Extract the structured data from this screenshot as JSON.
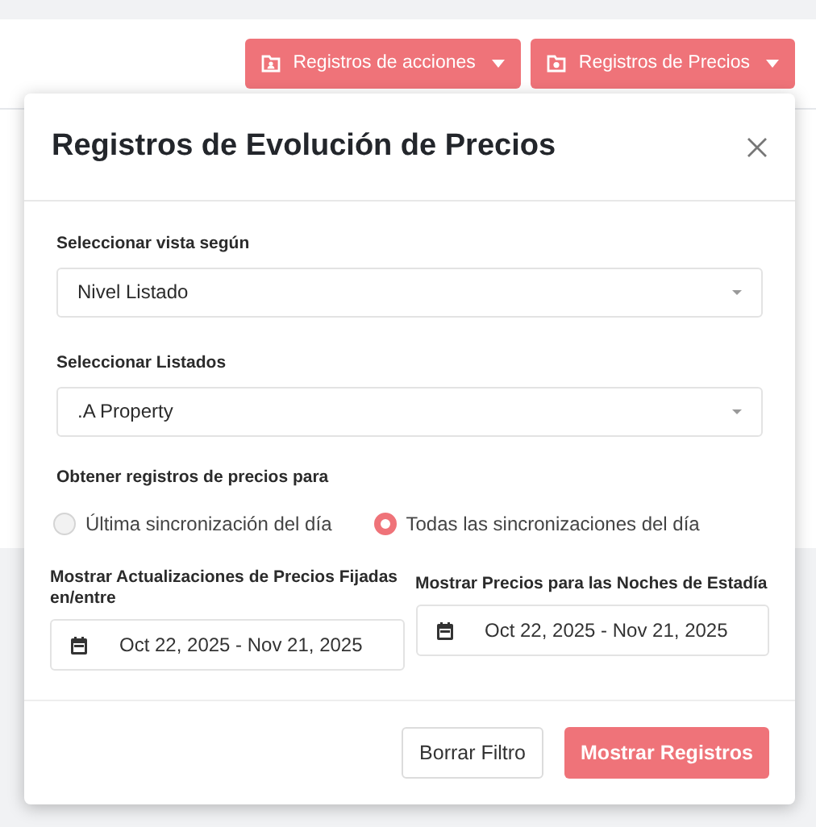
{
  "toolbar": {
    "buttons": [
      {
        "label": "Registros de acciones"
      },
      {
        "label": "Registros de Precios"
      }
    ]
  },
  "dialog": {
    "title": "Registros de Evolución de Precios",
    "view_select": {
      "label": "Seleccionar vista según",
      "value": "Nivel Listado"
    },
    "listing_select": {
      "label": "Seleccionar Listados",
      "value": ".A Property"
    },
    "sync_options": {
      "label": "Obtener registros de precios para",
      "options": [
        {
          "label": "Última sincronización del día",
          "selected": false
        },
        {
          "label": "Todas las sincronizaciones del día",
          "selected": true
        }
      ]
    },
    "date_ranges": [
      {
        "label": "Mostrar Actualizaciones de Precios Fijadas en/entre",
        "value": "Oct 22, 2025 - Nov 21, 2025"
      },
      {
        "label": "Mostrar Precios para las Noches de Estadía",
        "value": "Oct 22, 2025 - Nov 21, 2025"
      }
    ],
    "buttons": [
      {
        "label": "Borrar Filtro",
        "kind": "secondary"
      },
      {
        "label": "Mostrar Registros",
        "kind": "primary"
      }
    ]
  }
}
